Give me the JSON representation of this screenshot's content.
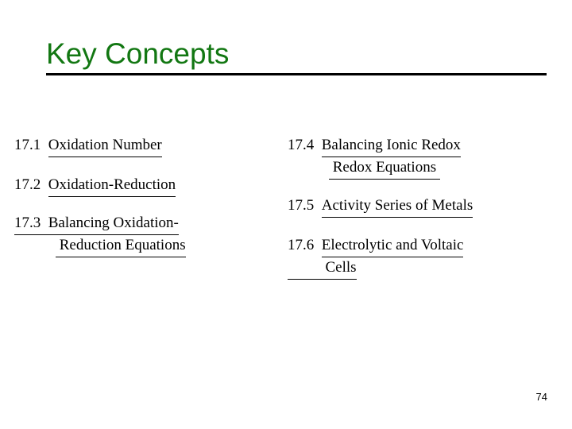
{
  "slide": {
    "title": "Key Concepts",
    "title_color": "#127712",
    "rule_color": "#000000",
    "background_color": "#ffffff",
    "page_number": "74"
  },
  "columns": {
    "left": [
      {
        "number": "17.1",
        "lines": [
          "Oxidation Number"
        ],
        "underline_number": false
      },
      {
        "number": "17.2",
        "lines": [
          "Oxidation-Reduction"
        ],
        "underline_number": false
      },
      {
        "number": "17.3",
        "lines": [
          "Balancing Oxidation-",
          " Reduction Equations"
        ],
        "underline_number": true
      }
    ],
    "right": [
      {
        "number": "17.4",
        "lines": [
          "Balancing Ionic Redox",
          " Redox Equations "
        ],
        "underline_number": false
      },
      {
        "number": "17.5",
        "lines": [
          "Activity Series of Metals"
        ],
        "underline_number": false
      },
      {
        "number": "17.6",
        "lines": [
          "Electrolytic and Voltaic",
          "          Cells"
        ],
        "underline_number": false
      }
    ]
  }
}
